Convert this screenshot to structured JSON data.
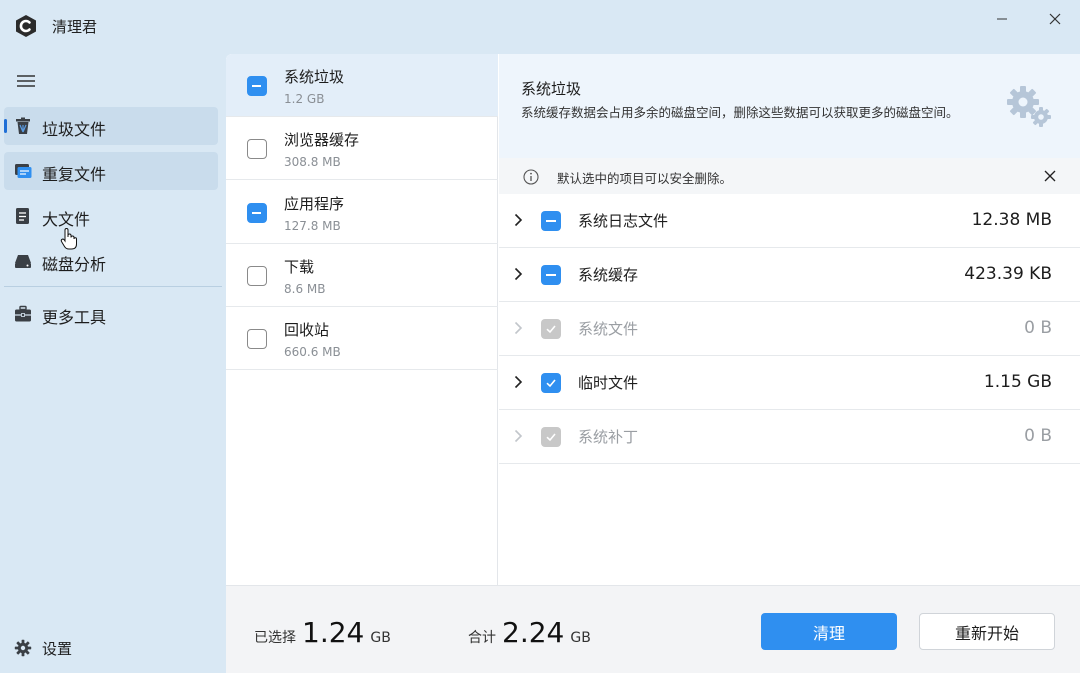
{
  "app": {
    "title": "清理君"
  },
  "sidebar": {
    "items": [
      {
        "label": "垃圾文件",
        "icon": "trash-icon"
      },
      {
        "label": "重复文件",
        "icon": "duplicate-files-icon"
      },
      {
        "label": "大文件",
        "icon": "large-file-icon"
      },
      {
        "label": "磁盘分析",
        "icon": "disk-icon"
      },
      {
        "label": "更多工具",
        "icon": "toolbox-icon"
      }
    ],
    "settings_label": "设置"
  },
  "categories": [
    {
      "name": "系统垃圾",
      "size": "1.2 GB",
      "state": "partial"
    },
    {
      "name": "浏览器缓存",
      "size": "308.8 MB",
      "state": "unchecked"
    },
    {
      "name": "应用程序",
      "size": "127.8 MB",
      "state": "partial"
    },
    {
      "name": "下载",
      "size": "8.6 MB",
      "state": "unchecked"
    },
    {
      "name": "回收站",
      "size": "660.6 MB",
      "state": "unchecked"
    }
  ],
  "detail": {
    "title": "系统垃圾",
    "description": "系统缓存数据会占用多余的磁盘空间，删除这些数据可以获取更多的磁盘空间。",
    "info": "默认选中的项目可以安全删除。",
    "rows": [
      {
        "name": "系统日志文件",
        "size": "12.38 MB",
        "state": "partial",
        "disabled": false
      },
      {
        "name": "系统缓存",
        "size": "423.39 KB",
        "state": "partial",
        "disabled": false
      },
      {
        "name": "系统文件",
        "size": "0 B",
        "state": "checked",
        "disabled": true
      },
      {
        "name": "临时文件",
        "size": "1.15 GB",
        "state": "checked",
        "disabled": false
      },
      {
        "name": "系统补丁",
        "size": "0 B",
        "state": "checked",
        "disabled": true
      }
    ]
  },
  "footer": {
    "selected_label": "已选择",
    "selected_value": "1.24",
    "selected_unit": "GB",
    "total_label": "合计",
    "total_value": "2.24",
    "total_unit": "GB",
    "clean_label": "清理",
    "restart_label": "重新开始"
  },
  "colors": {
    "accent": "#2f8ff0",
    "sidebar_bg": "#d9e8f4",
    "active_indicator": "#1f6fd6"
  }
}
